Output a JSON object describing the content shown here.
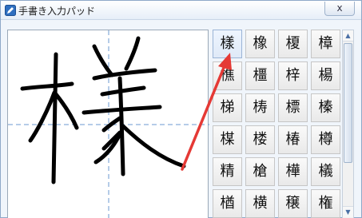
{
  "window": {
    "title": "手書き入力パッド",
    "close_label": "x"
  },
  "candidates": [
    [
      "樣",
      "橡",
      "榎",
      "樟"
    ],
    [
      "樵",
      "橿",
      "梓",
      "楊"
    ],
    [
      "梯",
      "梼",
      "標",
      "榛"
    ],
    [
      "楳",
      "楼",
      "椿",
      "樽"
    ],
    [
      "精",
      "槍",
      "樺",
      "檥"
    ],
    [
      "楢",
      "横",
      "穣",
      "権"
    ]
  ],
  "scrollbar": {
    "up_icon": "chevron-up-icon",
    "down_icon": "chevron-down-icon"
  },
  "colors": {
    "arrow": "#e53935",
    "ink": "#000000",
    "guide": "#6b9ad1"
  }
}
